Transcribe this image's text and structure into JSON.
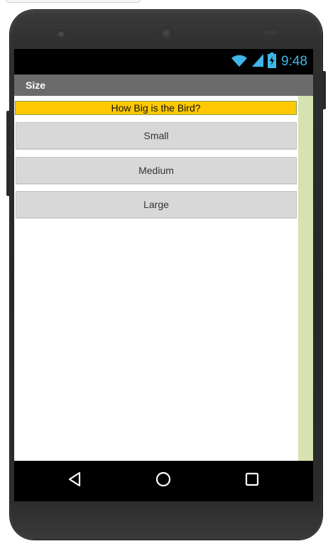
{
  "status_bar": {
    "time": "9:48",
    "icons": [
      "wifi-icon",
      "signal-icon",
      "battery-charging-icon"
    ],
    "accent_color": "#3fb6e8"
  },
  "title_bar": {
    "title": "Size",
    "background": "#6b6b6b"
  },
  "main": {
    "question_label": "How Big is the Bird?",
    "question_background": "#ffc800",
    "options": [
      {
        "label": "Small"
      },
      {
        "label": "Medium"
      },
      {
        "label": "Large"
      }
    ]
  },
  "nav_bar": {
    "icons": [
      "back-triangle-icon",
      "home-circle-icon",
      "recents-square-icon"
    ]
  }
}
